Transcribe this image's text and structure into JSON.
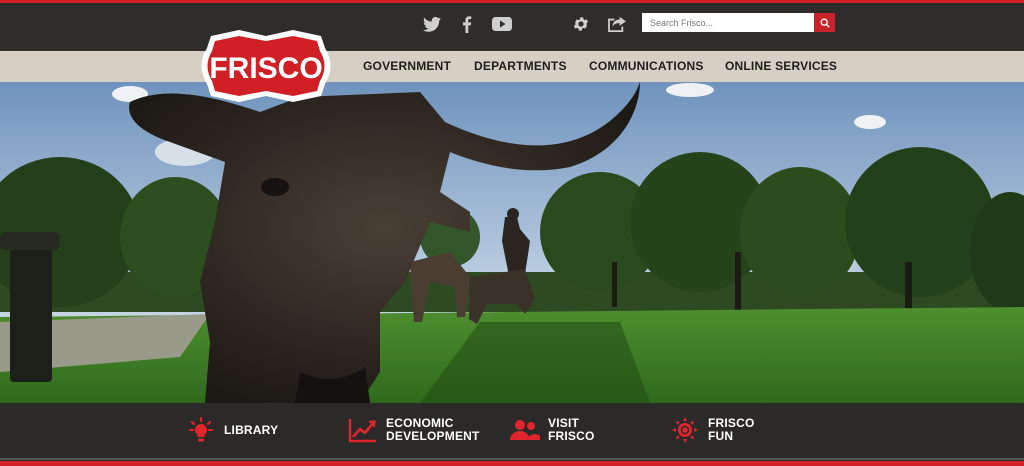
{
  "header": {
    "social_icons": [
      "twitter-icon",
      "facebook-icon",
      "youtube-icon"
    ],
    "tool_icons": [
      "gear-icon",
      "share-icon"
    ],
    "search": {
      "placeholder": "Search Frisco..."
    },
    "logo_text": "FRISCO"
  },
  "nav": {
    "items": [
      {
        "label": "GOVERNMENT"
      },
      {
        "label": "DEPARTMENTS"
      },
      {
        "label": "COMMUNICATIONS"
      },
      {
        "label": "ONLINE SERVICES"
      }
    ]
  },
  "quick_links": [
    {
      "label": "LIBRARY",
      "icon": "lightbulb-icon"
    },
    {
      "label": "ECONOMIC\nDEVELOPMENT",
      "icon": "line-chart-icon"
    },
    {
      "label": "VISIT\nFRISCO",
      "icon": "people-icon"
    },
    {
      "label": "FRISCO\nFUN",
      "icon": "sun-icon"
    }
  ],
  "colors": {
    "accent_red": "#c8232a",
    "header_dark": "#2e2d2b",
    "nav_tan": "#d6cfc3"
  }
}
